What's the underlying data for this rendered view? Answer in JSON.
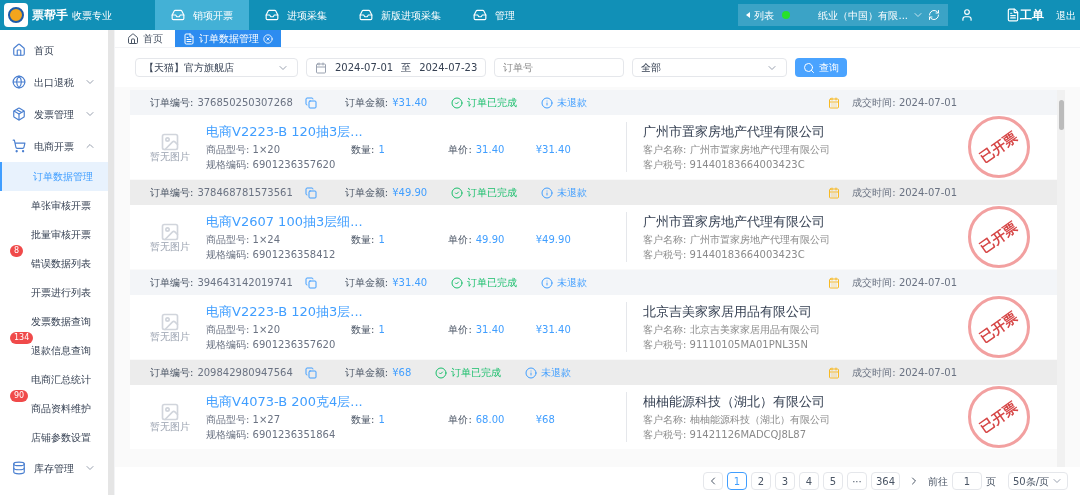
{
  "header": {
    "app_name": "票帮手",
    "app_tagline": "收票专业",
    "nav": [
      {
        "label": "销项开票",
        "selected": true
      },
      {
        "label": "进项采集",
        "selected": false
      },
      {
        "label": "新版进项采集",
        "selected": false
      },
      {
        "label": "管理",
        "selected": false
      }
    ],
    "switch_label": "列表",
    "company": "纸业（中国）有限...",
    "work_order": "工单",
    "logout": "退出"
  },
  "sidebar": {
    "items": [
      {
        "label": "首页",
        "expanded": false,
        "expandable": false
      },
      {
        "label": "出口退税",
        "expanded": false,
        "expandable": true
      },
      {
        "label": "发票管理",
        "expanded": false,
        "expandable": true
      },
      {
        "label": "电商开票",
        "expanded": true,
        "expandable": true,
        "children": [
          {
            "label": "订单数据管理",
            "selected": true
          },
          {
            "label": "单张审核开票",
            "selected": false
          },
          {
            "label": "批量审核开票",
            "selected": false
          },
          {
            "label": "错误数据列表",
            "selected": false,
            "badge": "8"
          },
          {
            "label": "开票进行列表",
            "selected": false
          },
          {
            "label": "发票数据查询",
            "selected": false
          },
          {
            "label": "退款信息查询",
            "selected": false,
            "badge": "134"
          },
          {
            "label": "电商汇总统计",
            "selected": false
          },
          {
            "label": "商品资料维护",
            "selected": false,
            "badge": "90"
          },
          {
            "label": "店铺参数设置",
            "selected": false
          }
        ]
      },
      {
        "label": "库存管理",
        "expanded": false,
        "expandable": true
      }
    ]
  },
  "page_tabs": [
    {
      "label": "首页",
      "selected": false
    },
    {
      "label": "订单数据管理",
      "selected": true
    }
  ],
  "filters": {
    "store": "【天猫】官方旗舰店",
    "date_from": "2024-07-01",
    "date_sep": "至",
    "date_to": "2024-07-23",
    "order_placeholder": "订单号",
    "status": "全部",
    "search_button": "查询"
  },
  "orders": [
    {
      "highlighted": false,
      "order_label": "订单编号:",
      "order_no": "376850250307268",
      "amount_label": "订单金额:",
      "amount": "¥31.40",
      "status": "订单已完成",
      "refund": "未退款",
      "time": "成交时间: 2024-07-01",
      "image_placeholder": "暂无图片",
      "product": "电商V2223-B 120抽3层...",
      "model": "商品型号: 1×20",
      "code": "规格编码: 6901236357620",
      "qty_label": "数量:",
      "qty": "1",
      "price_label": "单价:",
      "price": "31.40",
      "total": "¥31.40",
      "company": "广州市置家房地产代理有限公司",
      "customer": "客户名称: 广州市置家房地产代理有限公司",
      "tax_no": "客户税号: 91440183664003423C",
      "stamp": "已开票"
    },
    {
      "highlighted": true,
      "order_label": "订单编号:",
      "order_no": "378468781573561",
      "amount_label": "订单金额:",
      "amount": "¥49.90",
      "status": "订单已完成",
      "refund": "未退款",
      "time": "成交时间: 2024-07-01",
      "image_placeholder": "暂无图片",
      "product": "电商V2607 100抽3层细...",
      "model": "商品型号: 1×24",
      "code": "规格编码: 6901236358412",
      "qty_label": "数量:",
      "qty": "1",
      "price_label": "单价:",
      "price": "49.90",
      "total": "¥49.90",
      "company": "广州市置家房地产代理有限公司",
      "customer": "客户名称: 广州市置家房地产代理有限公司",
      "tax_no": "客户税号: 91440183664003423C",
      "stamp": "已开票"
    },
    {
      "highlighted": false,
      "order_label": "订单编号:",
      "order_no": "394643142019741",
      "amount_label": "订单金额:",
      "amount": "¥31.40",
      "status": "订单已完成",
      "refund": "未退款",
      "time": "成交时间: 2024-07-01",
      "image_placeholder": "暂无图片",
      "product": "电商V2223-B 120抽3层...",
      "model": "商品型号: 1×20",
      "code": "规格编码: 6901236357620",
      "qty_label": "数量:",
      "qty": "1",
      "price_label": "单价:",
      "price": "31.40",
      "total": "¥31.40",
      "company": "北京吉美家家居用品有限公司",
      "customer": "客户名称: 北京吉美家家居用品有限公司",
      "tax_no": "客户税号: 91110105MA01PNL35N",
      "stamp": "已开票"
    },
    {
      "highlighted": true,
      "order_label": "订单编号:",
      "order_no": "209842980947564",
      "amount_label": "订单金额:",
      "amount": "¥68",
      "status": "订单已完成",
      "refund": "未退款",
      "time": "成交时间: 2024-07-01",
      "image_placeholder": "暂无图片",
      "product": "电商V4073-B 200克4层...",
      "model": "商品型号: 1×27",
      "code": "规格编码: 6901236351864",
      "qty_label": "数量:",
      "qty": "1",
      "price_label": "单价:",
      "price": "68.00",
      "total": "¥68",
      "company": "柚柚能源科技（湖北）有限公司",
      "customer": "客户名称: 柚柚能源科技（湖北）有限公司",
      "tax_no": "客户税号: 91421126MADCQJ8L87",
      "stamp": "已开票"
    }
  ],
  "pagination": {
    "pages": [
      {
        "label": "1",
        "selected": true
      },
      {
        "label": "2",
        "selected": false
      },
      {
        "label": "3",
        "selected": false
      },
      {
        "label": "4",
        "selected": false
      },
      {
        "label": "5",
        "selected": false
      },
      {
        "label": "···",
        "selected": false
      },
      {
        "label": "364",
        "selected": false
      }
    ],
    "goto_label": "前往",
    "goto_value": "1",
    "page_unit": "页",
    "page_size": "50条/页"
  }
}
